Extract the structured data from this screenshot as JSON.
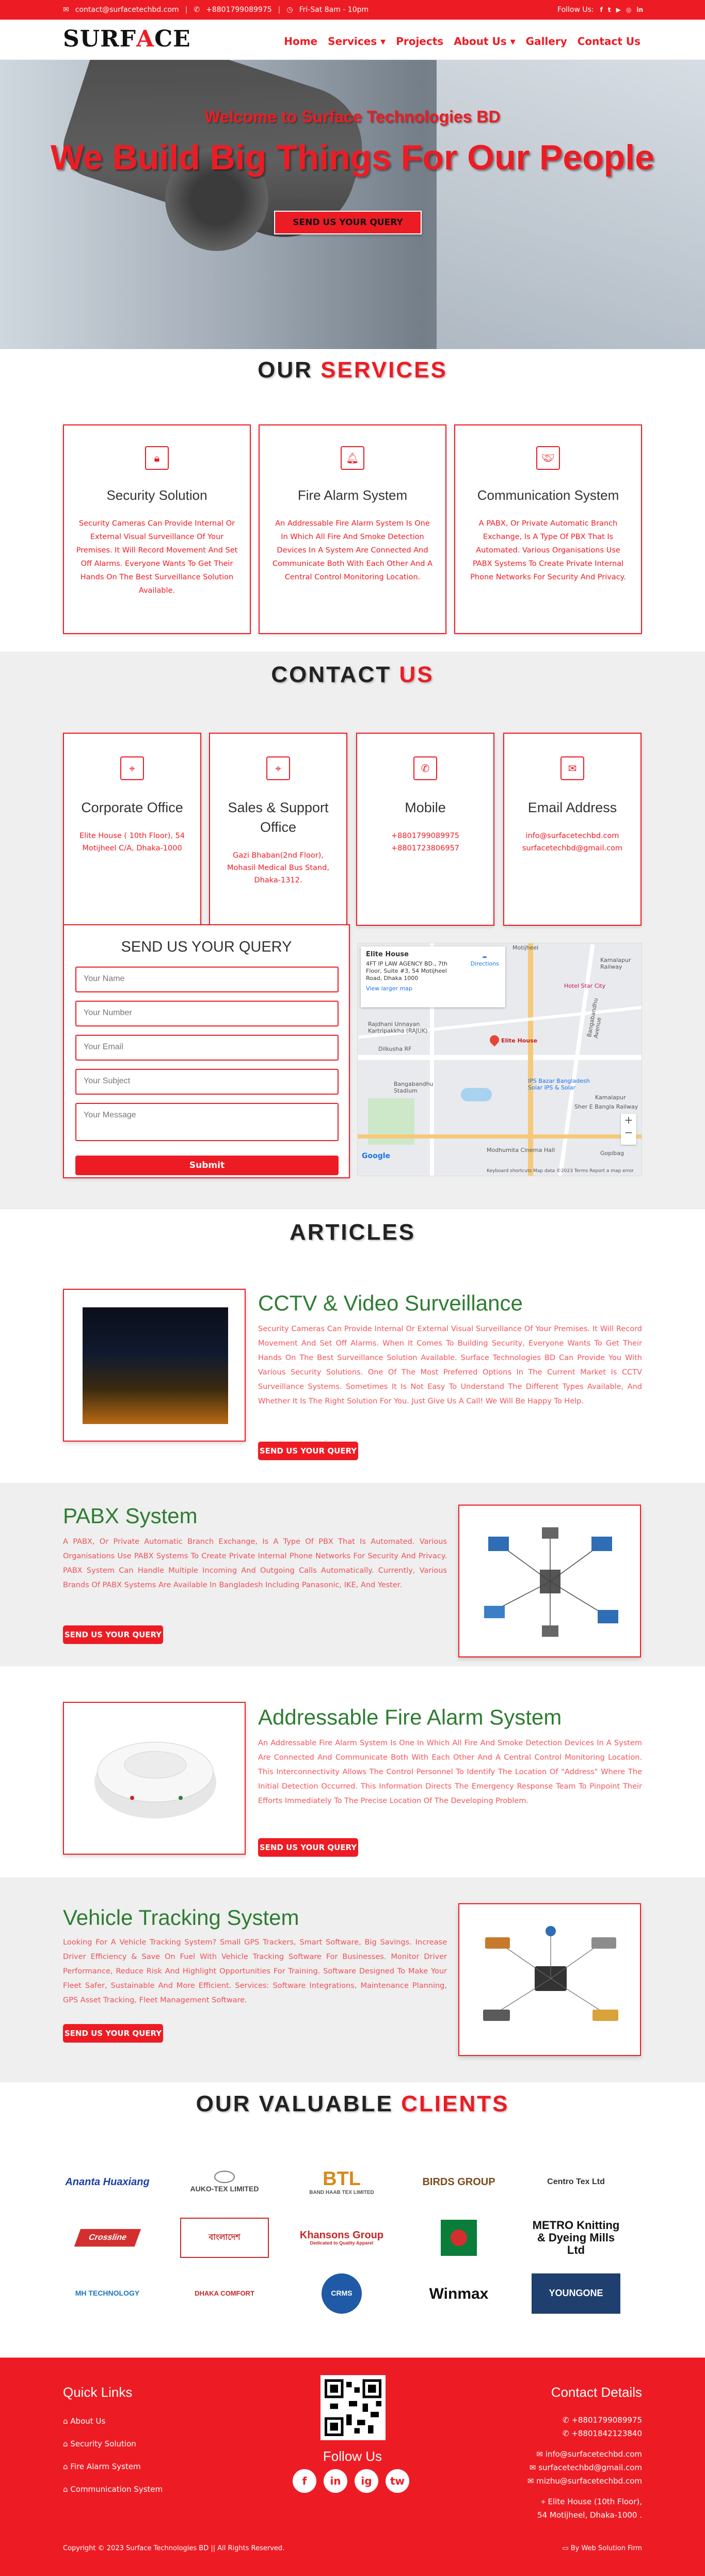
{
  "topbar": {
    "email": "contact@surfacetechbd.com",
    "phone": "+8801799089975",
    "hours": "Fri-Sat 8am - 10pm",
    "follow": "Follow Us:"
  },
  "nav": {
    "logo_left": "SURF",
    "logo_mid": "A",
    "logo_right": "CE",
    "items": [
      "Home",
      "Services ▾",
      "Projects",
      "About Us ▾",
      "Gallery",
      "Contact Us"
    ]
  },
  "hero": {
    "welcome": "Welcome to Surface Technologies BD",
    "headline": "We Build Big Things For Our People",
    "button": "SEND US YOUR QUERY"
  },
  "services": {
    "title_a": "OUR",
    "title_b": "SERVICES",
    "cards": [
      {
        "icon": "lock-icon",
        "title": "Security Solution",
        "text": "Security Cameras Can Provide Internal Or External Visual Surveillance Of Your Premises. It Will Record Movement And Set Off Alarms. Everyone Wants To Get Their Hands On The Best Surveillance Solution Available."
      },
      {
        "icon": "bell-icon",
        "title": "Fire Alarm System",
        "text": "An Addressable Fire Alarm System Is One In Which All Fire And Smoke Detection Devices In A System Are Connected And Communicate Both With Each Other And A Central Control Monitoring Location."
      },
      {
        "icon": "handshake-icon",
        "title": "Communication System",
        "text": "A PABX, Or Private Automatic Branch Exchange, Is A Type Of PBX That Is Automated. Various Organisations Use PABX Systems To Create Private Internal Phone Networks For Security And Privacy."
      }
    ]
  },
  "contact": {
    "title_a": "CONTACT",
    "title_b": "US",
    "cards": [
      {
        "icon": "location-icon",
        "title": "Corporate Office",
        "lines": [
          "Elite House ( 10th Floor), 54",
          "Motijheel C/A, Dhaka-1000"
        ]
      },
      {
        "icon": "location-icon",
        "title": "Sales & Support Office",
        "lines": [
          "Gazi Bhaban(2nd Floor),",
          "Mohasil Medical Bus Stand,",
          "Dhaka-1312."
        ]
      },
      {
        "icon": "phone-icon",
        "title": "Mobile",
        "lines": [
          "+8801799089975",
          "+8801723806957"
        ]
      },
      {
        "icon": "mail-icon",
        "title": "Email Address",
        "lines": [
          "info@surfacetechbd.com",
          "surfacetechbd@gmail.com"
        ]
      }
    ],
    "form": {
      "title": "SEND US YOUR QUERY",
      "name": "Your Name",
      "number": "Your Number",
      "email": "Your Email",
      "subject": "Your Subject",
      "message": "Your Message",
      "submit": "Submit"
    },
    "map": {
      "place": "Elite House",
      "address": "4FT IP LAW AGENCY BD., 7th Floor, Suite #3, 54 Motijheel Road, Dhaka 1000",
      "larger": "View larger map",
      "directions": "Directions",
      "pin_label": "Elite House",
      "labels": [
        "Motijheel",
        "Kamalapur Railway",
        "Rajdhani Unnayan Kartripakkha (RAJUK)",
        "Dilkusha RF",
        "Bangabandhu Stadium",
        "Hotel Star City",
        "IPS Bazar Bangladesh Solar IPS & Solar",
        "Bangabandhu Avenue",
        "Sher E Bangla Railway",
        "Modhumita Cinema Hall",
        "Kamalapur",
        "Gopibag"
      ],
      "footer": "Keyboard shortcuts   Map data ©2023   Terms   Report a map error",
      "zoom_in": "+",
      "zoom_out": "−"
    }
  },
  "articles": {
    "title": "ARTICLES",
    "items": [
      {
        "title": "CCTV & Video Surveillance",
        "text": "Security Cameras Can Provide Internal Or External Visual Surveillance Of Your Premises. It Will Record Movement And Set Off Alarms. When It Comes To Building Security, Everyone Wants To Get Their Hands On The Best Surveillance Solution Available. Surface Technologies BD Can Provide You With Various Security Solutions. One Of The Most Preferred Options In The Current Market Is CCTV Surveillance Systems. Sometimes It Is Not Easy To Understand The Different Types Available, And Whether It Is The Right Solution For You. Just Give Us A Call! We Will Be Happy To Help.",
        "button": "SEND US YOUR QUERY"
      },
      {
        "title": "PABX System",
        "text": "A PABX, Or Private Automatic Branch Exchange, Is A Type Of PBX That Is Automated. Various Organisations Use PABX Systems To Create Private Internal Phone Networks For Security And Privacy. PABX System Can Handle Multiple Incoming And Outgoing Calls Automatically. Currently, Various Brands Of PABX Systems Are Available In Bangladesh Including Panasonic, IKE, And Yester.",
        "button": "SEND US YOUR QUERY"
      },
      {
        "title": "Addressable Fire Alarm System",
        "text": "An Addressable Fire Alarm System Is One In Which All Fire And Smoke Detection Devices In A System Are Connected And Communicate Both With Each Other And A Central Control Monitoring Location. This Interconnectivity Allows The Control Personnel To Identify The Location Of \"Address\" Where The Initial Detection Occurred. This Information Directs The Emergency Response Team To Pinpoint Their Efforts Immediately To The Precise Location Of The Developing Problem.",
        "button": "SEND US YOUR QUERY"
      },
      {
        "title": "Vehicle Tracking System",
        "text": "Looking For A Vehicle Tracking System? Small GPS Trackers, Smart Software, Big Savings. Increase Driver Efficiency & Save On Fuel With Vehicle Tracking Software For Businesses. Monitor Driver Performance, Reduce Risk And Highlight Opportunities For Training. Software Designed To Make Your Fleet Safer, Sustainable And More Efficient. Services: Software Integrations, Maintenance Planning, GPS Asset Tracking, Fleet Management Software.",
        "button": "SEND US YOUR QUERY"
      }
    ]
  },
  "clients": {
    "title_a": "OUR VALUABLE",
    "title_b": "CLIENTS",
    "logos": [
      "Ananta Huaxiang",
      "AUKO-TEX LIMITED",
      "BTL",
      "BIRDS GROUP",
      "Centro Tex Ltd",
      "Crossline",
      "বাংলাদেশ",
      "Khansons Group",
      "Bangladesh Logo",
      "METRO Knitting & Dyeing Mills Ltd",
      "MH TECHNOLOGY",
      "DHAKA COMFORT",
      "CRMS",
      "Winmax",
      "YOUNGONE"
    ],
    "logo_sub": {
      "btl": "BAND HAAB TEX LIMITED",
      "khansons": "Dedicated to Quality Apparel"
    }
  },
  "footer": {
    "quick_title": "Quick Links",
    "links": [
      "About Us",
      "Security Solution",
      "Fire Alarm System",
      "Communication System"
    ],
    "follow": "Follow Us",
    "social": [
      "f",
      "in",
      "ig",
      "tw"
    ],
    "contact_title": "Contact Details",
    "contact_lines": [
      "+8801799089975",
      "+8801842123840",
      "info@surfacetechbd.com",
      "surfacetechbd@gmail.com",
      "mizhu@surfacetechbd.com",
      "Elite House (10th Floor),",
      "54 Motijheel, Dhaka-1000 ."
    ],
    "copyright": "Copyright © 2023 Surface Technologies BD || All Rights Reserved.",
    "credit": "By Web Solution Firm"
  }
}
